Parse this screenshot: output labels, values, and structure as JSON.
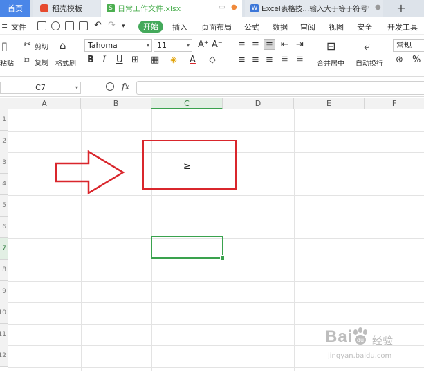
{
  "tabs": {
    "home": "首页",
    "daoke": "稻壳模板",
    "file": "日常工作文件.xlsx",
    "file_icon": "S",
    "excel": "Excel表格技...输入大于等于符号",
    "excel_icon": "W",
    "new_tab": "+"
  },
  "menu": {
    "file": "文件",
    "start": "开始",
    "items": [
      "插入",
      "页面布局",
      "公式",
      "数据",
      "审阅",
      "视图",
      "安全",
      "开发工具"
    ]
  },
  "ribbon": {
    "cut": "剪切",
    "paste": "粘贴",
    "copy": "复制",
    "format_painter": "格式刷",
    "font_name": "Tahoma",
    "font_size": "11",
    "bold": "B",
    "italic": "I",
    "underline": "U",
    "grow_font": "A⁺",
    "shrink_font": "A⁻",
    "merge_center": "合并居中",
    "wrap_text": "自动换行",
    "number_format": "常规"
  },
  "formula_bar": {
    "name_box": "C7",
    "fx": "fx",
    "formula": ""
  },
  "grid": {
    "columns": [
      "A",
      "B",
      "C",
      "D",
      "E",
      "F"
    ],
    "active_column": "C",
    "rows": [
      "1",
      "2",
      "3",
      "4",
      "5",
      "6",
      "7",
      "8",
      "9",
      "10",
      "11",
      "12"
    ],
    "active_row": "7",
    "cell_c3": "≥"
  },
  "colors": {
    "accent_green": "#3aa24e",
    "highlight_red": "#d9262c",
    "tab_blue": "#4a86e8"
  },
  "watermark": {
    "brand": "Bai",
    "brand2": "du",
    "sub": "经验",
    "url": "jingyan.baidu.com"
  }
}
